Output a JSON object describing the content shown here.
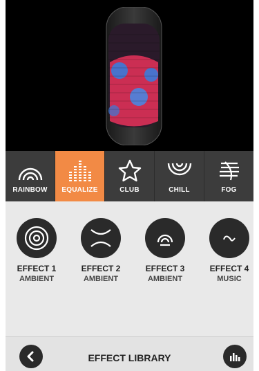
{
  "preview": {
    "background": "#000000",
    "led_colors": [
      "#ff3347",
      "#3b7bd9"
    ]
  },
  "tabs": [
    {
      "label": "RAINBOW",
      "icon": "rainbow-icon",
      "active": false
    },
    {
      "label": "EQUALIZE",
      "icon": "equalizer-icon",
      "active": true
    },
    {
      "label": "CLUB",
      "icon": "star-icon",
      "active": false
    },
    {
      "label": "CHILL",
      "icon": "chill-waves-icon",
      "active": false
    },
    {
      "label": "FOG",
      "icon": "fog-icon",
      "active": false
    }
  ],
  "effects": [
    {
      "title": "EFFECT 1",
      "subtitle": "AMBIENT",
      "icon": "concentric-rings-icon"
    },
    {
      "title": "EFFECT 2",
      "subtitle": "AMBIENT",
      "icon": "curves-icon"
    },
    {
      "title": "EFFECT 3",
      "subtitle": "AMBIENT",
      "icon": "arch-icon"
    },
    {
      "title": "EFFECT 4",
      "subtitle": "MUSIC",
      "icon": "wave-icon"
    }
  ],
  "bottom_bar": {
    "title": "EFFECT LIBRARY",
    "back_icon": "chevron-left-icon",
    "right_icon": "equalizer-bars-icon"
  },
  "colors": {
    "accent": "#f28a45",
    "tab_bg": "#3c3c3c",
    "dark": "#2a2a2a"
  }
}
